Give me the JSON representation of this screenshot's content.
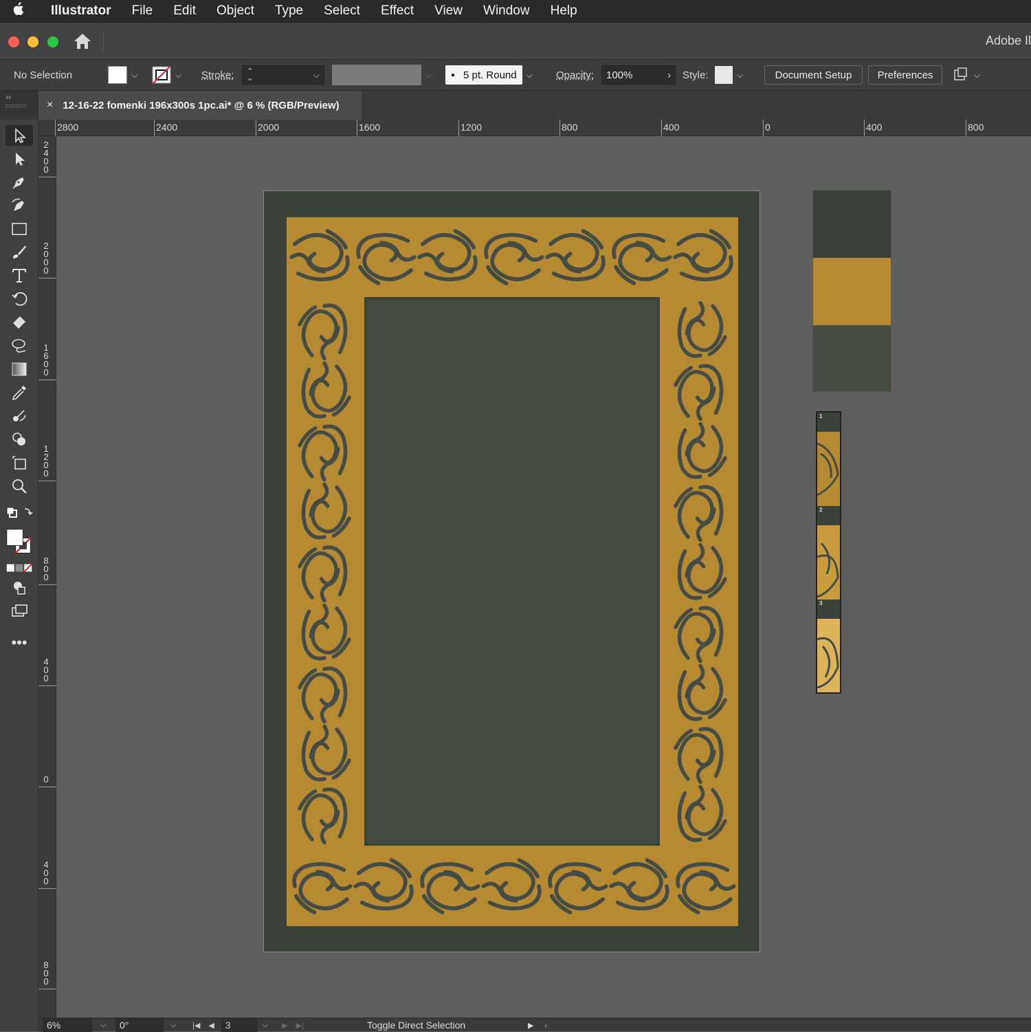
{
  "menubar": {
    "app_name": "Illustrator",
    "items": [
      "File",
      "Edit",
      "Object",
      "Type",
      "Select",
      "Effect",
      "View",
      "Window",
      "Help"
    ]
  },
  "titlebar": {
    "app_title": "Adobe Il"
  },
  "control_bar": {
    "selection_status": "No Selection",
    "stroke_label": "Stroke:",
    "brush_value": "5 pt. Round",
    "opacity_label": "Opacity:",
    "opacity_value": "100%",
    "style_label": "Style:",
    "document_setup_label": "Document Setup",
    "preferences_label": "Preferences"
  },
  "document_tab": {
    "title": "12-16-22 fomenki 196x300s 1pc.ai* @ 6 % (RGB/Preview)",
    "close_glyph": "×"
  },
  "ruler_top": {
    "labels": [
      "2800",
      "2400",
      "2000",
      "1600",
      "1200",
      "800",
      "400",
      "0",
      "400",
      "800"
    ]
  },
  "ruler_left": {
    "labels": [
      "2400",
      "2000",
      "1600",
      "1200",
      "800",
      "400",
      "0",
      "400",
      "800"
    ]
  },
  "artwork_colors": {
    "background": "#3b4239",
    "gold": "#b58a33",
    "inner_panel": "#454d43"
  },
  "swatch_strip": {
    "page_numbers": [
      "1",
      "2",
      "3"
    ]
  },
  "status_bar": {
    "zoom": "6%",
    "rotation": "0°",
    "artboard_number": "3",
    "status_text": "Toggle Direct Selection"
  },
  "icons": {
    "tools": [
      "selection-tool-icon",
      "direct-selection-tool-icon",
      "pen-tool-icon",
      "curvature-tool-icon",
      "rectangle-tool-icon",
      "paintbrush-tool-icon",
      "type-tool-icon",
      "rotate-tool-icon",
      "eraser-tool-icon",
      "lasso-tool-icon",
      "gradient-tool-icon",
      "eyedropper-tool-icon",
      "blend-tool-icon",
      "shape-builder-tool-icon",
      "artboard-tool-icon",
      "zoom-tool-icon"
    ]
  }
}
